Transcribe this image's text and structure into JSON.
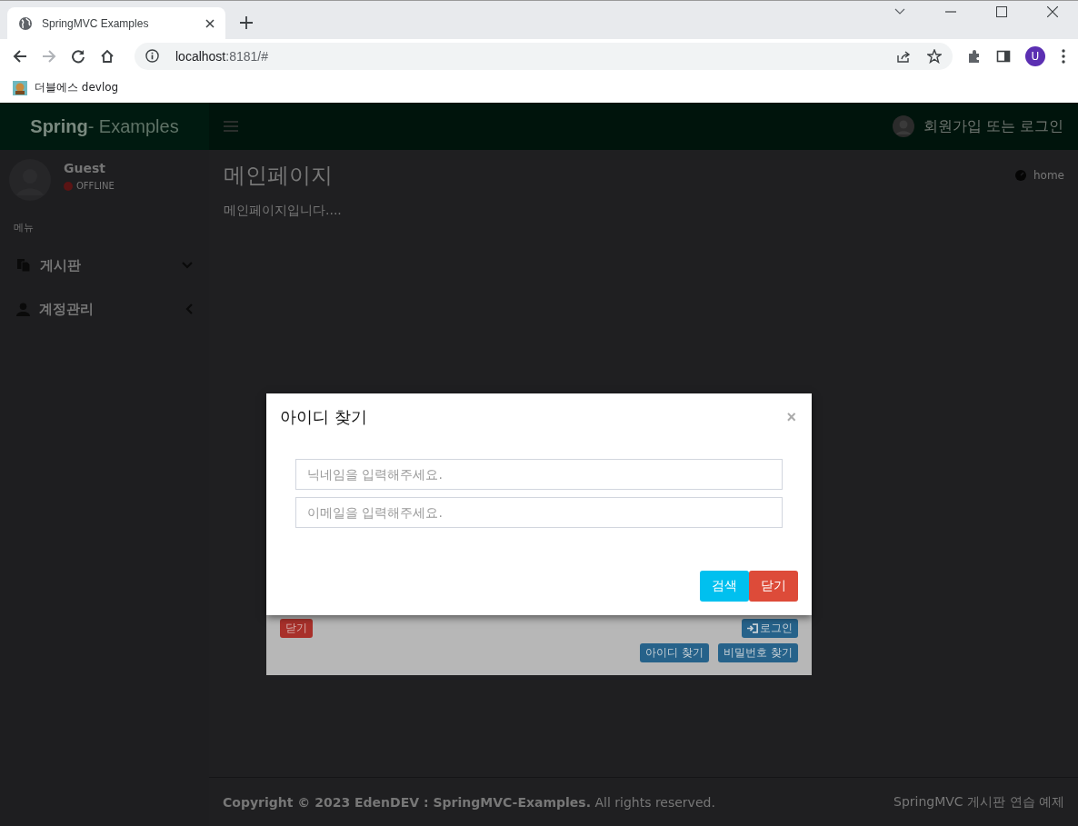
{
  "browser": {
    "tab_title": "SpringMVC Examples",
    "url_host": "localhost",
    "url_path": ":8181/#",
    "bookmarks": [
      {
        "label": "더블에스 devlog"
      }
    ],
    "profile_initial": "U"
  },
  "app": {
    "logo": {
      "bold": "Spring",
      "rest": " - Examples"
    },
    "user_menu": "회원가입 또는 로그인",
    "sidebar": {
      "user_name": "Guest",
      "status": "OFFLINE",
      "header": "메뉴",
      "items": [
        {
          "label": "게시판",
          "expanded": true
        },
        {
          "label": "계정관리",
          "expanded": false
        }
      ]
    },
    "content": {
      "title": "메인페이지",
      "breadcrumb": "home",
      "body": "메인페이지입니다...."
    },
    "footer": {
      "copyright": "**Copyright © 2023 EdenDEV : SpringMVC-Examples.** All rights reserved.",
      "right": "SpringMVC 게시판 연습 예제"
    }
  },
  "login_modal": {
    "buttons": [
      {
        "label": "닫기",
        "kind": "danger"
      },
      {
        "label": "로그인",
        "kind": "primary"
      },
      {
        "label": "아이디 찾기",
        "kind": "primary"
      },
      {
        "label": "비밀번호 찾기",
        "kind": "primary"
      }
    ]
  },
  "find_id_modal": {
    "title": "아이디 찾기",
    "close": "×",
    "fields": [
      {
        "placeholder": "닉네임을 입력해주세요."
      },
      {
        "placeholder": "이메일을 입력해주세요."
      }
    ],
    "buttons": [
      {
        "label": "검색",
        "kind": "info"
      },
      {
        "label": "닫기",
        "kind": "danger"
      }
    ]
  }
}
